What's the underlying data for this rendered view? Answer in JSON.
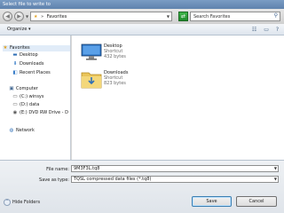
{
  "window": {
    "title": "Select file to write to"
  },
  "address": {
    "back_icon": "back-arrow-icon",
    "forward_icon": "forward-arrow-icon",
    "path_items": [
      "Favorites"
    ],
    "search_placeholder": "Search Favorites"
  },
  "toolbar": {
    "organize_label": "Organize ▾",
    "view_icon": "views-icon",
    "pane_icon": "preview-pane-icon",
    "help_icon": "help-icon"
  },
  "sidebar": {
    "items": [
      {
        "label": "Favorites",
        "icon": "star-icon",
        "selected": true
      },
      {
        "label": "Desktop",
        "icon": "desktop-icon"
      },
      {
        "label": "Downloads",
        "icon": "downloads-icon"
      },
      {
        "label": "Recent Places",
        "icon": "recent-places-icon"
      },
      {
        "label": "Computer",
        "icon": "computer-icon"
      },
      {
        "label": "(C:) winsys",
        "icon": "drive-icon"
      },
      {
        "label": "(D:) data",
        "icon": "drive-icon"
      },
      {
        "label": "(E:) DVD RW Drive - D",
        "icon": "dvd-drive-icon"
      },
      {
        "label": "Network",
        "icon": "network-icon"
      }
    ]
  },
  "files": [
    {
      "name": "Desktop",
      "type": "Shortcut",
      "size": "432 bytes",
      "icon": "desktop-shortcut-icon"
    },
    {
      "name": "Downloads",
      "type": "Shortcut",
      "size": "823 bytes",
      "icon": "downloads-folder-icon"
    }
  ],
  "form": {
    "filename_label": "File name:",
    "filename_value": "9M3F3L.tq8",
    "savetype_label": "Save as type:",
    "savetype_value": "TQSL compressed data files (*.tq8)"
  },
  "buttons": {
    "hide_folders": "Hide Folders",
    "save": "Save",
    "cancel": "Cancel"
  }
}
